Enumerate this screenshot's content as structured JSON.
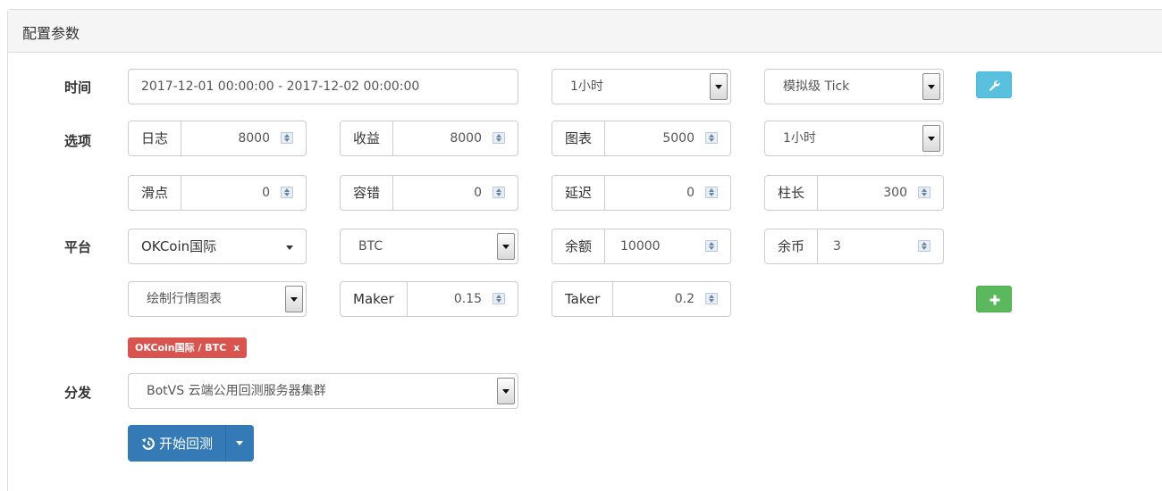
{
  "panel": {
    "title": "配置参数"
  },
  "rows": {
    "time_label": "时间",
    "options_label": "选项",
    "platform_label": "平台",
    "dispatch_label": "分发"
  },
  "time": {
    "range": "2017-12-01 00:00:00 - 2017-12-02 00:00:00",
    "period": "1小时",
    "mode": "模拟级 Tick",
    "settings_icon": "wrench-icon"
  },
  "options": {
    "log": {
      "label": "日志",
      "value": "8000"
    },
    "profit": {
      "label": "收益",
      "value": "8000"
    },
    "chart": {
      "label": "图表",
      "value": "5000"
    },
    "chart_period": "1小时",
    "slippage": {
      "label": "滑点",
      "value": "0"
    },
    "tolerance": {
      "label": "容错",
      "value": "0"
    },
    "delay": {
      "label": "延迟",
      "value": "0"
    },
    "bar_length": {
      "label": "柱长",
      "value": "300"
    }
  },
  "platform": {
    "exchange": "OKCoin国际",
    "currency": "BTC",
    "balance": {
      "label": "余额",
      "value": "10000"
    },
    "coins": {
      "label": "余币",
      "value": "3"
    },
    "chart_option": "绘制行情图表",
    "maker": {
      "label": "Maker",
      "value": "0.15"
    },
    "taker": {
      "label": "Taker",
      "value": "0.2"
    },
    "add_icon": "plus-icon",
    "tag": {
      "text": "OKCoin国际 / BTC",
      "remove": "x"
    }
  },
  "dispatch": {
    "server": "BotVS 云端公用回测服务器集群"
  },
  "start": {
    "label": "开始回测",
    "icon": "history-icon"
  },
  "colors": {
    "primary": "#337ab7",
    "info": "#5bc0de",
    "success": "#5cb85c",
    "danger": "#d9534f"
  }
}
